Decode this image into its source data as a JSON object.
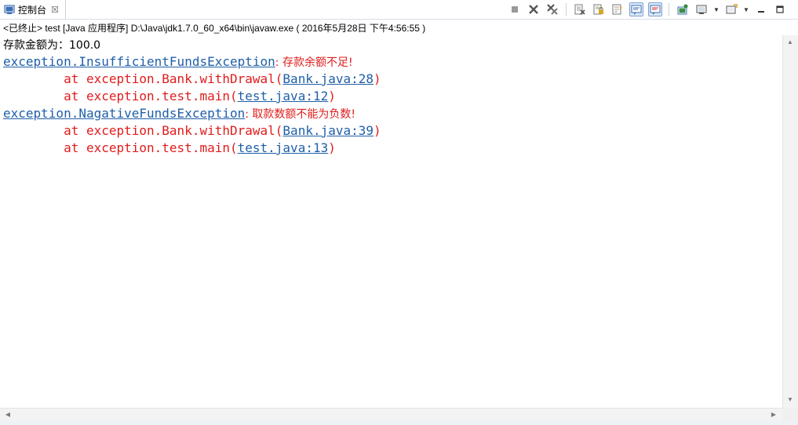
{
  "tab": {
    "label": "控制台",
    "close": "☒"
  },
  "toolbar": {
    "buttons": [
      {
        "name": "terminate-icon",
        "pressed": false
      },
      {
        "name": "remove-launch-icon",
        "pressed": false
      },
      {
        "name": "remove-all-terminated-icon",
        "pressed": false
      },
      {
        "name": "clear-console-icon",
        "pressed": false
      },
      {
        "name": "scroll-lock-icon",
        "pressed": false
      },
      {
        "name": "word-wrap-icon",
        "pressed": false
      },
      {
        "name": "show-on-stdout-icon",
        "pressed": true
      },
      {
        "name": "show-on-stderr-icon",
        "pressed": true
      },
      {
        "name": "pin-console-icon",
        "pressed": false
      },
      {
        "name": "display-selected-console-icon",
        "pressed": false
      },
      {
        "name": "open-console-icon",
        "pressed": false
      },
      {
        "name": "minimize-icon",
        "pressed": false
      },
      {
        "name": "maximize-icon",
        "pressed": false
      }
    ]
  },
  "launch_description": "<已终止> test [Java 应用程序] D:\\Java\\jdk1.7.0_60_x64\\bin\\javaw.exe ( 2016年5月28日 下午4:56:55 )",
  "console": {
    "line1": "存款金额为：100.0",
    "exc1_class": "exception.InsufficientFundsException",
    "exc1_msg": ": 存款余额不足!",
    "exc1_at1_prefix": "        at exception.Bank.withDrawal(",
    "exc1_at1_link": "Bank.java:28",
    "exc1_at1_suffix": ")",
    "exc1_at2_prefix": "        at exception.test.main(",
    "exc1_at2_link": "test.java:12",
    "exc1_at2_suffix": ")",
    "exc2_class": "exception.NagativeFundsException",
    "exc2_msg": ": 取款数额不能为负数!",
    "exc2_at1_prefix": "        at exception.Bank.withDrawal(",
    "exc2_at1_link": "Bank.java:39",
    "exc2_at1_suffix": ")",
    "exc2_at2_prefix": "        at exception.test.main(",
    "exc2_at2_link": "test.java:13",
    "exc2_at2_suffix": ")"
  },
  "scroll": {
    "up": "▲",
    "down": "▼",
    "left": "◀",
    "right": "▶"
  },
  "colors": {
    "error": "#e01c1c",
    "link": "#1f5fa8",
    "stdout": "#000000"
  }
}
